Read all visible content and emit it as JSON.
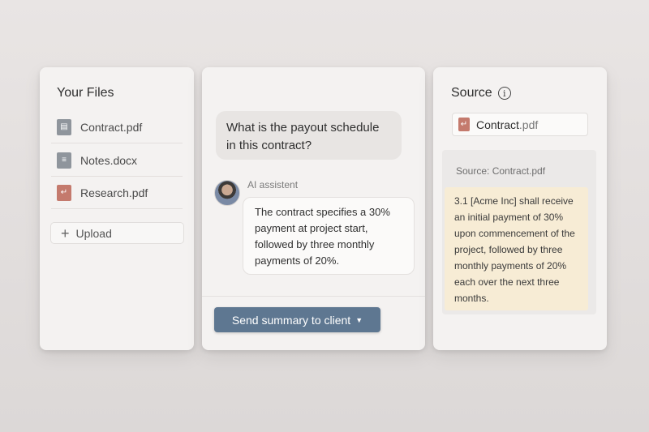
{
  "files_panel": {
    "title": "Your Files",
    "files": [
      {
        "name": "Contract.pdf",
        "icon": "pdf-file-icon",
        "color": "#8f959c"
      },
      {
        "name": "Notes.docx",
        "icon": "doc-file-icon",
        "color": "#8f959c"
      },
      {
        "name": "Research.pdf",
        "icon": "pdf-file-icon",
        "color": "#c47a6d"
      }
    ],
    "upload_label": "Upload"
  },
  "chat_panel": {
    "user_message": "What is the payout schedule in this contract?",
    "assistant_label": "AI assistent",
    "assistant_message": "The contract specifies a 30% payment at project start, followed by three monthly payments of 20%.",
    "send_button_label": "Send summary to client",
    "accent": "#5e7791"
  },
  "source_panel": {
    "title": "Source",
    "file_base": "Contract",
    "file_ext": ".pdf",
    "caption": "Source: Contract.pdf",
    "quote": "3.1 [Acme Inc] shall receive an initial payment of 30% upon commencement of the project, followed by three monthly payments of 20% each over the next three months.",
    "highlight_color": "#f7ecd5"
  }
}
